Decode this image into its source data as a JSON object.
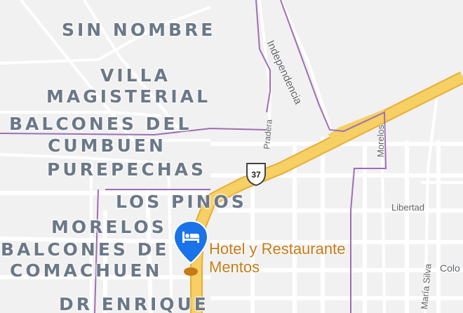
{
  "map": {
    "neighborhoods": {
      "sin_nombre": "SIN NOMBRE",
      "villa_magisterial_1": "VILLA",
      "villa_magisterial_2": "MAGISTERIAL",
      "balcones_cumbuen_1": "BALCONES DEL",
      "balcones_cumbuen_2": "CUMBUEN",
      "purepechas": "PUREPECHAS",
      "los_pinos": "LOS PINOS",
      "morelos": "MORELOS",
      "balcones_comachuen_1": "BALCONES DE",
      "balcones_comachuen_2": "COMACHUEN",
      "dr_enrique": "DR ENRIQUE"
    },
    "streets": {
      "independencia": "Independencia",
      "pradera": "Pradera",
      "morelos": "Morelos",
      "libertad": "Libertad",
      "maria_silva": "María Silva",
      "colon": "Colo"
    },
    "route_shield": "37",
    "poi": {
      "line1": "Hotel y Restaurante",
      "line2": "Mentos",
      "icon": "hotel-bed-icon"
    },
    "colors": {
      "background": "#f1f1f1",
      "highway": "#f6cf65",
      "boundary": "#9e6fb3",
      "poi": "#c77a14",
      "marker": "#1a73e8"
    }
  }
}
